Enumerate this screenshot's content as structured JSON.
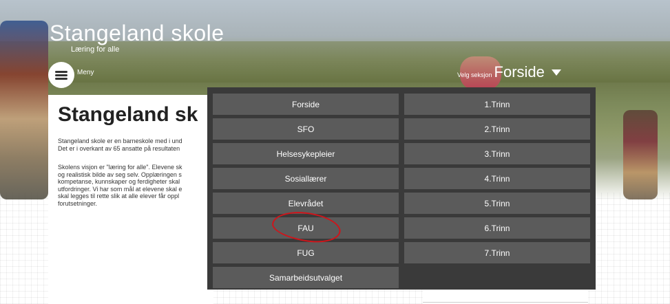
{
  "site": {
    "title": "Stangeland skole",
    "subtitle": "Læring for alle"
  },
  "menu": {
    "label": "Meny",
    "icon": "hamburger-icon"
  },
  "section_picker": {
    "prefix": "Velg seksjon",
    "current": "Forside",
    "icon": "caret-down-icon"
  },
  "content": {
    "heading": "Stangeland sk",
    "paragraph1": "Stangeland skole er en barneskole med i und\nDet er i overkant av 65 ansatte på resultaten",
    "paragraph2": "Skolens visjon er \"læring for alle\". Elevene sk\nog realistisk bilde av seg selv. Opplæringen s\nkompetanse, kunnskaper og ferdigheter skal\nutfordringer. Vi har som mål at elevene skal e\nskal legges til rette slik at alle elever får oppl\nforutsetninger."
  },
  "dropdown": {
    "left": [
      "Forside",
      "SFO",
      "Helsesykepleier",
      "Sosiallærer",
      "Elevrådet",
      "FAU",
      "FUG",
      "Samarbeidsutvalget"
    ],
    "right": [
      "1.Trinn",
      "2.Trinn",
      "3.Trinn",
      "4.Trinn",
      "5.Trinn",
      "6.Trinn",
      "7.Trinn"
    ]
  },
  "annotation": {
    "color": "#d0141a",
    "target": "FAU"
  }
}
